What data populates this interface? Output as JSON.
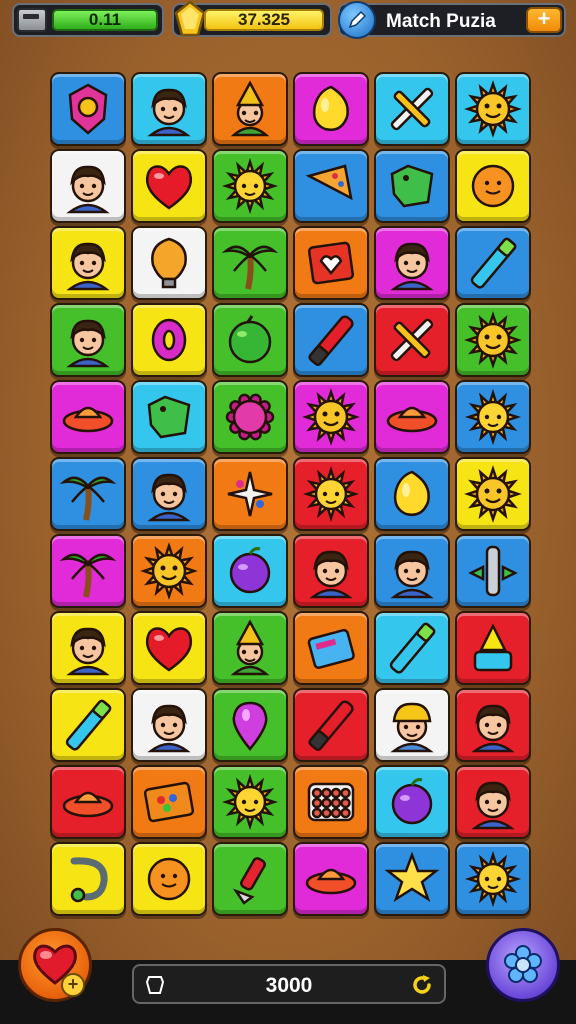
{
  "header": {
    "energy_value": "0.11",
    "coins_value": "37.325",
    "title": "Match Puzia",
    "add_label": "+"
  },
  "footer": {
    "score": "3000",
    "add_life_label": "+"
  },
  "colors": {
    "blue": "#2f8fe0",
    "cyan": "#35c6ee",
    "orange": "#f27a14",
    "magenta": "#e12bd8",
    "yellow": "#f7e414",
    "green": "#45c02a",
    "red": "#e5202b",
    "white": "#f4f4f4",
    "purple": "#c330e6"
  },
  "board": {
    "rows": [
      [
        {
          "bg": "blue",
          "icon": "badge-icon"
        },
        {
          "bg": "cyan",
          "icon": "boy-icon"
        },
        {
          "bg": "orange",
          "icon": "gnome-icon"
        },
        {
          "bg": "magenta",
          "icon": "lemon-icon"
        },
        {
          "bg": "cyan",
          "icon": "pencil-cross-icon"
        },
        {
          "bg": "cyan",
          "icon": "sun-face-icon"
        }
      ],
      [
        {
          "bg": "white",
          "icon": "boy-icon"
        },
        {
          "bg": "yellow",
          "icon": "heart-icon"
        },
        {
          "bg": "green",
          "icon": "sun-icon"
        },
        {
          "bg": "blue",
          "icon": "palette-icon"
        },
        {
          "bg": "blue",
          "icon": "tag-icon"
        },
        {
          "bg": "yellow",
          "icon": "orange-ball-icon"
        }
      ],
      [
        {
          "bg": "yellow",
          "icon": "boy-icon"
        },
        {
          "bg": "white",
          "icon": "bulb-icon"
        },
        {
          "bg": "green",
          "icon": "palm-icon"
        },
        {
          "bg": "orange",
          "icon": "box-heart-icon"
        },
        {
          "bg": "magenta",
          "icon": "boy-icon"
        },
        {
          "bg": "blue",
          "icon": "marker-icon"
        }
      ],
      [
        {
          "bg": "green",
          "icon": "boy-icon"
        },
        {
          "bg": "yellow",
          "icon": "ring-icon"
        },
        {
          "bg": "green",
          "icon": "green-ball-icon"
        },
        {
          "bg": "blue",
          "icon": "red-marker-icon"
        },
        {
          "bg": "red",
          "icon": "pencil-cross-icon"
        },
        {
          "bg": "green",
          "icon": "sun-face-icon"
        }
      ],
      [
        {
          "bg": "magenta",
          "icon": "ufo-icon"
        },
        {
          "bg": "cyan",
          "icon": "tag-icon"
        },
        {
          "bg": "green",
          "icon": "gear-badge-icon"
        },
        {
          "bg": "magenta",
          "icon": "sun-face-icon"
        },
        {
          "bg": "magenta",
          "icon": "ufo-icon"
        },
        {
          "bg": "blue",
          "icon": "sun-icon"
        }
      ],
      [
        {
          "bg": "blue",
          "icon": "palm-icon"
        },
        {
          "bg": "blue",
          "icon": "boy-icon"
        },
        {
          "bg": "orange",
          "icon": "sparkle-icon"
        },
        {
          "bg": "red",
          "icon": "sun-icon"
        },
        {
          "bg": "blue",
          "icon": "lemon-icon"
        },
        {
          "bg": "yellow",
          "icon": "sun-face-icon"
        }
      ],
      [
        {
          "bg": "magenta",
          "icon": "palm-icon"
        },
        {
          "bg": "orange",
          "icon": "sun-face-icon"
        },
        {
          "bg": "cyan",
          "icon": "plum-icon"
        },
        {
          "bg": "red",
          "icon": "boy-icon"
        },
        {
          "bg": "blue",
          "icon": "boy-icon"
        },
        {
          "bg": "blue",
          "icon": "tube-icon"
        }
      ],
      [
        {
          "bg": "yellow",
          "icon": "boy-icon"
        },
        {
          "bg": "yellow",
          "icon": "heart-icon"
        },
        {
          "bg": "green",
          "icon": "gnome-icon"
        },
        {
          "bg": "orange",
          "icon": "book-icon"
        },
        {
          "bg": "cyan",
          "icon": "marker-icon"
        },
        {
          "bg": "red",
          "icon": "letters-icon"
        }
      ],
      [
        {
          "bg": "yellow",
          "icon": "marker-icon"
        },
        {
          "bg": "white",
          "icon": "boy-icon"
        },
        {
          "bg": "green",
          "icon": "pin-icon"
        },
        {
          "bg": "red",
          "icon": "red-marker-icon"
        },
        {
          "bg": "white",
          "icon": "worker-icon"
        },
        {
          "bg": "red",
          "icon": "boy-icon"
        }
      ],
      [
        {
          "bg": "red",
          "icon": "ufo-icon"
        },
        {
          "bg": "orange",
          "icon": "paint-box-icon"
        },
        {
          "bg": "green",
          "icon": "sun-icon"
        },
        {
          "bg": "orange",
          "icon": "candy-tray-icon"
        },
        {
          "bg": "cyan",
          "icon": "plum-icon"
        },
        {
          "bg": "red",
          "icon": "boy-icon"
        }
      ],
      [
        {
          "bg": "yellow",
          "icon": "hook-icon"
        },
        {
          "bg": "yellow",
          "icon": "orange-ball-icon"
        },
        {
          "bg": "green",
          "icon": "syringe-icon"
        },
        {
          "bg": "magenta",
          "icon": "ufo-icon"
        },
        {
          "bg": "blue",
          "icon": "star-2k-icon"
        },
        {
          "bg": "blue",
          "icon": "sun-icon"
        }
      ]
    ]
  }
}
